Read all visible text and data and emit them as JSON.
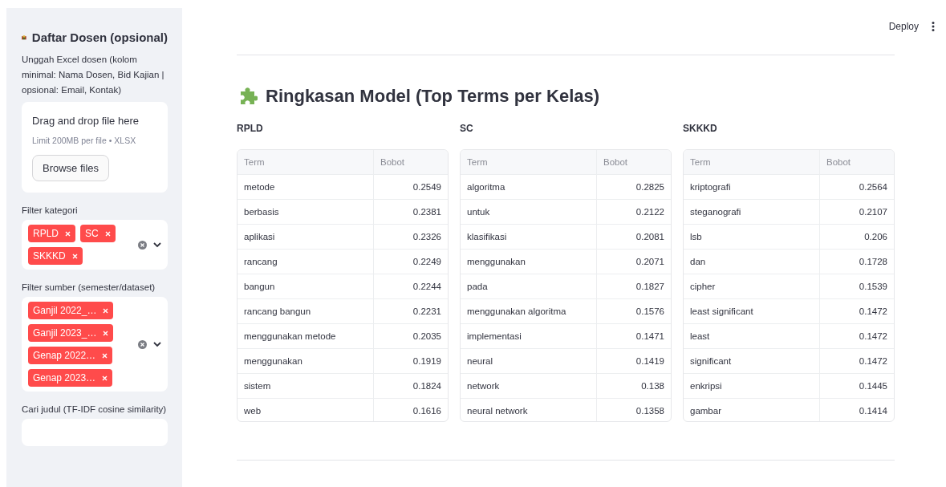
{
  "header": {
    "deploy": "Deploy"
  },
  "sidebar": {
    "title": "Daftar Dosen (opsional)",
    "upload_hint": "Unggah Excel dosen (kolom minimal: Nama Dosen, Bid Kajian | opsional: Email, Kontak)",
    "uploader": {
      "drop_text": "Drag and drop file here",
      "limit_text": "Limit 200MB per file • XLSX",
      "button": "Browse files"
    },
    "filters": [
      {
        "label": "Filter kategori",
        "tags": [
          "RPLD",
          "SC",
          "SKKKD"
        ]
      },
      {
        "label": "Filter sumber (semester/dataset)",
        "tags": [
          "Ganjil 2022_…",
          "Ganjil 2023_…",
          "Genap 2022…",
          "Genap 2023…"
        ]
      }
    ],
    "search": {
      "label": "Cari judul (TF-IDF cosine similarity)"
    }
  },
  "main": {
    "title": "Ringkasan Model (Top Terms per Kelas)",
    "tables": [
      {
        "heading": "RPLD",
        "columns": [
          "Term",
          "Bobot"
        ],
        "rows": [
          [
            "metode",
            "0.2549"
          ],
          [
            "berbasis",
            "0.2381"
          ],
          [
            "aplikasi",
            "0.2326"
          ],
          [
            "rancang",
            "0.2249"
          ],
          [
            "bangun",
            "0.2244"
          ],
          [
            "rancang bangun",
            "0.2231"
          ],
          [
            "menggunakan metode",
            "0.2035"
          ],
          [
            "menggunakan",
            "0.1919"
          ],
          [
            "sistem",
            "0.1824"
          ],
          [
            "web",
            "0.1616"
          ]
        ]
      },
      {
        "heading": "SC",
        "columns": [
          "Term",
          "Bobot"
        ],
        "rows": [
          [
            "algoritma",
            "0.2825"
          ],
          [
            "untuk",
            "0.2122"
          ],
          [
            "klasifikasi",
            "0.2081"
          ],
          [
            "menggunakan",
            "0.2071"
          ],
          [
            "pada",
            "0.1827"
          ],
          [
            "menggunakan algoritma",
            "0.1576"
          ],
          [
            "implementasi",
            "0.1471"
          ],
          [
            "neural",
            "0.1419"
          ],
          [
            "network",
            "0.138"
          ],
          [
            "neural network",
            "0.1358"
          ]
        ]
      },
      {
        "heading": "SKKKD",
        "columns": [
          "Term",
          "Bobot"
        ],
        "rows": [
          [
            "kriptografi",
            "0.2564"
          ],
          [
            "steganografi",
            "0.2107"
          ],
          [
            "lsb",
            "0.206"
          ],
          [
            "dan",
            "0.1728"
          ],
          [
            "cipher",
            "0.1539"
          ],
          [
            "least significant",
            "0.1472"
          ],
          [
            "least",
            "0.1472"
          ],
          [
            "significant",
            "0.1472"
          ],
          [
            "enkripsi",
            "0.1445"
          ],
          [
            "gambar",
            "0.1414"
          ]
        ]
      }
    ]
  }
}
